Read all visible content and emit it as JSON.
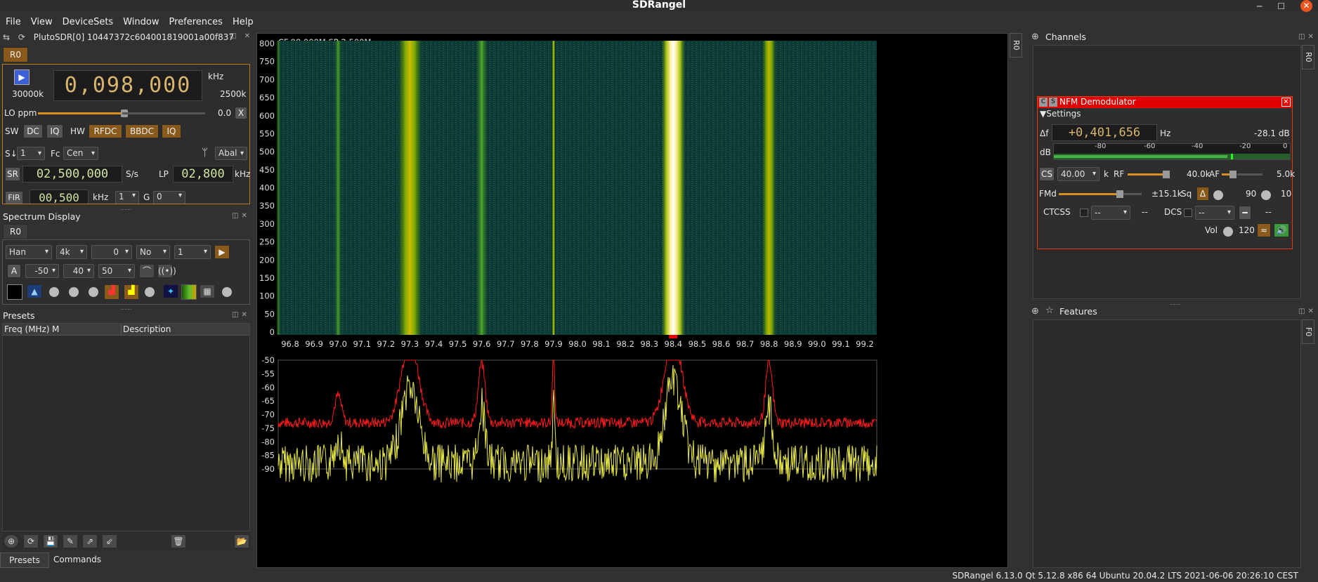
{
  "app_title": "SDRangel",
  "menu": [
    "File",
    "View",
    "DeviceSets",
    "Window",
    "Preferences",
    "Help"
  ],
  "device": {
    "name": "PlutoSDR[0] 10447372c604001819001a00f837",
    "tab": "R0",
    "center_freq": "0,098,000",
    "freq_unit": "kHz",
    "bw_left": "30000k",
    "bw_right": "2500k",
    "lo_ppm_label": "LO ppm",
    "lo_ppm_value": "0.0",
    "lo_reset": "X",
    "sw_label": "SW",
    "dc": "DC",
    "iq": "IQ",
    "hw_label": "HW",
    "rfdc": "RFDC",
    "bbdc": "BBDC",
    "iq2": "IQ",
    "s_label": "S↓",
    "s_value": "1",
    "fc_label": "Fc",
    "fc_value": "Cen",
    "antenna": "Abal",
    "sr_label": "SR",
    "sr_value": "02,500,000",
    "sr_unit": "S/s",
    "lp_label": "LP",
    "lp_value": "02,800",
    "lp_unit": "kHz",
    "fir_label": "FIR",
    "fir_value": "00,500",
    "fir_unit": "kHz",
    "fir_gain": "1",
    "g_label": "G",
    "g_value": "0"
  },
  "spectrum_display": {
    "title": "Spectrum Display",
    "tab": "R0",
    "window": "Han",
    "fft": "4k",
    "overlap": "0",
    "avg_mode": "No",
    "avg": "1",
    "a_label": "A",
    "ref": "-50",
    "range": "40",
    "fps": "50"
  },
  "presets": {
    "title": "Presets",
    "columns": [
      "Freq (MHz)",
      "M",
      "Description"
    ],
    "tabs": [
      "Presets",
      "Commands"
    ]
  },
  "spectrum": {
    "header": "CF:98.000M SP:2.500M",
    "side_tab": "R0",
    "waterfall_y": [
      "800",
      "750",
      "700",
      "650",
      "600",
      "550",
      "500",
      "450",
      "400",
      "350",
      "300",
      "250",
      "200",
      "150",
      "100",
      "50",
      "0"
    ],
    "freq_x": [
      "96.8",
      "96.9",
      "97.0",
      "97.1",
      "97.2",
      "97.3",
      "97.4",
      "97.5",
      "97.6",
      "97.7",
      "97.8",
      "97.9",
      "98.0",
      "98.1",
      "98.2",
      "98.3",
      "98.4",
      "98.5",
      "98.6",
      "98.7",
      "98.8",
      "98.9",
      "99.0",
      "99.1",
      "99.2"
    ],
    "power_y": [
      "-50",
      "-55",
      "-60",
      "-65",
      "-70",
      "-75",
      "-80",
      "-85",
      "-90"
    ]
  },
  "channels": {
    "title": "Channels",
    "side_tab": "R0",
    "demod_title": "NFM Demodulator",
    "settings_label": "Settings",
    "df_label": "Δf",
    "df_value": "+0,401,656",
    "df_unit": "Hz",
    "level": "-28.1 dB",
    "db_label": "dB",
    "db_scale": [
      "-80",
      "-60",
      "-40",
      "-20",
      "0"
    ],
    "cs_label": "CS",
    "cs_value": "40.00",
    "k_label": "k",
    "rf_label": "RF",
    "rf_value": "40.0k",
    "af_label": "AF",
    "af_value": "5.0k",
    "fmd_label": "FMd",
    "fmd_value": "±15.1k",
    "sq_label": "Sq",
    "sq_value": "90",
    "sq_delay": "10",
    "ctcss_label": "CTCSS",
    "ctcss_value": "--",
    "ctcss_dash": "--",
    "dcs_label": "DCS",
    "dcs_value": "--",
    "dcs_dash": "--",
    "vol_label": "Vol",
    "vol_value": "120"
  },
  "features": {
    "title": "Features",
    "side_tab": "F0"
  },
  "status_bar": "SDRangel 6.13.0 Qt 5.12.8 x86  64 Ubuntu 20.04.2 LTS  2021-06-06 20:26:10 CEST",
  "colors": {
    "accent_orange": "#8a5a1c",
    "demod_red": "#e00000",
    "peak_red": "#ff1a1a",
    "trace_yellow": "#f0f040"
  }
}
